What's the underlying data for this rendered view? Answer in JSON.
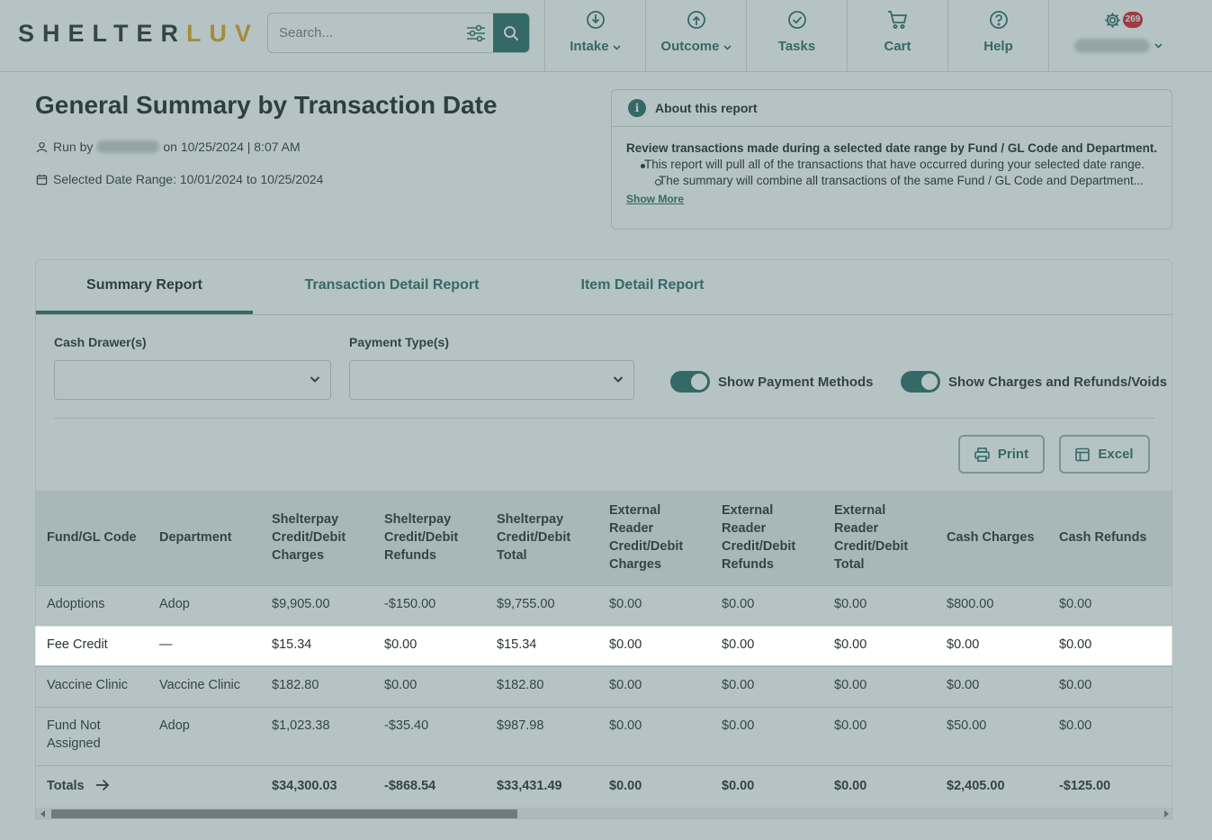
{
  "app": {
    "logo_prefix": "SHELTER",
    "logo_suffix": "LUV",
    "search_placeholder": "Search...",
    "nav": [
      {
        "label": "Intake",
        "icon": "intake-icon",
        "dropdown": true
      },
      {
        "label": "Outcome",
        "icon": "outcome-icon",
        "dropdown": true
      },
      {
        "label": "Tasks",
        "icon": "check-circle-icon",
        "dropdown": false
      },
      {
        "label": "Cart",
        "icon": "cart-icon",
        "dropdown": false
      },
      {
        "label": "Help",
        "icon": "help-icon",
        "dropdown": false
      }
    ],
    "notification_count": "269",
    "accent_color": "#2e6e69",
    "logo_accent_color": "#e0a823",
    "badge_color": "#d8232a"
  },
  "report": {
    "title": "General Summary by Transaction Date",
    "run_by_prefix": "Run by",
    "run_by_suffix": "on 10/25/2024 | 8:07 AM",
    "date_range": "Selected Date Range: 10/01/2024 to 10/25/2024"
  },
  "about": {
    "heading": "About this report",
    "lead": "Review transactions made during a selected date range by Fund / GL Code and Department.",
    "bullet": "This report will pull all of the transactions that have occurred during your selected date range.",
    "sub_bullet": "The summary will combine all transactions of the same Fund / GL Code and Department...",
    "show_more": "Show More"
  },
  "tabs": [
    "Summary Report",
    "Transaction Detail Report",
    "Item Detail Report"
  ],
  "filters": {
    "cash_drawer_label": "Cash Drawer(s)",
    "payment_type_label": "Payment Type(s)",
    "cash_drawer_value": "",
    "payment_type_value": "",
    "toggle_payment_methods": "Show Payment Methods",
    "toggle_payment_methods_on": true,
    "toggle_charges_refunds": "Show Charges and Refunds/Voids",
    "toggle_charges_refunds_on": true
  },
  "actions": {
    "print": "Print",
    "excel": "Excel"
  },
  "table": {
    "columns": [
      "Fund/GL Code",
      "Department",
      "Shelterpay Credit/Debit Charges",
      "Shelterpay Credit/Debit Refunds",
      "Shelterpay Credit/Debit Total",
      "External Reader Credit/Debit Charges",
      "External Reader Credit/Debit Refunds",
      "External Reader Credit/Debit Total",
      "Cash Charges",
      "Cash Refunds"
    ],
    "rows": [
      [
        "Adoptions",
        "Adop",
        "$9,905.00",
        "-$150.00",
        "$9,755.00",
        "$0.00",
        "$0.00",
        "$0.00",
        "$800.00",
        "$0.00"
      ],
      [
        "Fee Credit",
        "—",
        "$15.34",
        "$0.00",
        "$15.34",
        "$0.00",
        "$0.00",
        "$0.00",
        "$0.00",
        "$0.00"
      ],
      [
        "Vaccine Clinic",
        "Vaccine Clinic",
        "$182.80",
        "$0.00",
        "$182.80",
        "$0.00",
        "$0.00",
        "$0.00",
        "$0.00",
        "$0.00"
      ],
      [
        "Fund Not Assigned",
        "Adop",
        "$1,023.38",
        "-$35.40",
        "$987.98",
        "$0.00",
        "$0.00",
        "$0.00",
        "$50.00",
        "$0.00"
      ]
    ],
    "totals_label": "Totals",
    "totals": [
      "",
      "$34,300.03",
      "-$868.54",
      "$33,431.49",
      "$0.00",
      "$0.00",
      "$0.00",
      "$2,405.00",
      "-$125.00"
    ],
    "highlighted_row": 1
  }
}
